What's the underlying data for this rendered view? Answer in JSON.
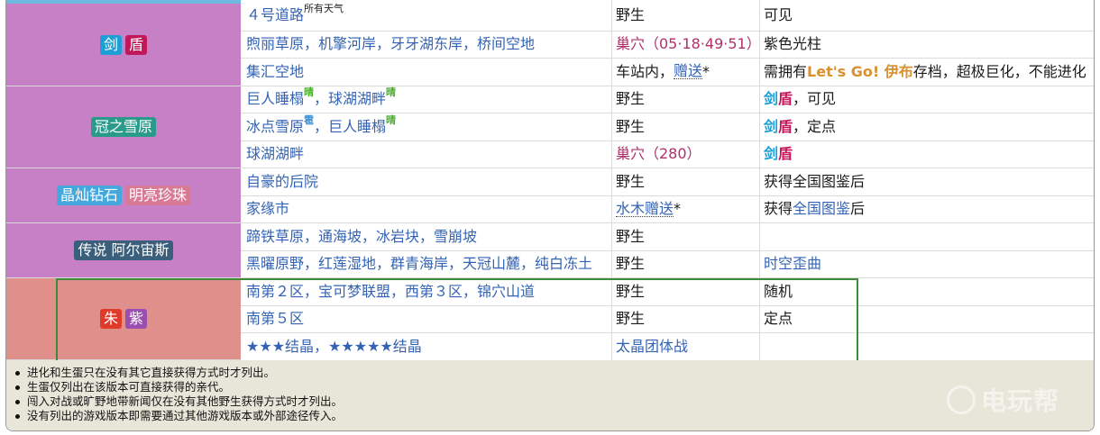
{
  "colors": {
    "sword": "#1d9fd6",
    "shield": "#c2185b",
    "crown_tundra": "#2a9a8a",
    "brilliant_diamond": "#45a8dc",
    "shining_pearl": "#d87a96",
    "legends_arceus": "#3b5f7a",
    "scarlet": "#e03a2a",
    "violet": "#9a4fb0",
    "link": "#3463b3",
    "highlight_border": "#3c8a3a"
  },
  "groups": [
    {
      "badges": [
        "剑",
        "盾"
      ]
    },
    {
      "badges": [
        "冠之雪原"
      ]
    },
    {
      "badges": [
        "晶灿钻石",
        "明亮珍珠"
      ]
    },
    {
      "badges": [
        "传说 阿尔宙斯"
      ]
    },
    {
      "badges": [
        "朱",
        "紫"
      ]
    }
  ],
  "rows": [
    {
      "loc": "４号道路",
      "loc_sup": "所有天气",
      "method": "野生",
      "note": "可见"
    },
    {
      "loc": "煦丽草原，机擎河岸，牙牙湖东岸，桥间空地",
      "method": "巢穴（05·18·49·51）",
      "note": "紫色光柱"
    },
    {
      "loc": "集汇空地",
      "method_a": "车站内，",
      "method_b": "赠送",
      "method_c": "*",
      "note_a": "需拥有",
      "note_b": "Let's Go! 伊布",
      "note_c": "存档，超极巨化，不能进化"
    },
    {
      "loc_a": "巨人睡榻",
      "loc_a_sup": "晴",
      "loc_b": "，球湖湖畔",
      "loc_b_sup": "晴",
      "method": "野生",
      "note_a": "剑",
      "note_b": "盾",
      "note_c": "，可见"
    },
    {
      "loc_a": "冰点雪原",
      "loc_a_sup": "雹",
      "loc_b": "，巨人睡榻",
      "loc_b_sup": "晴",
      "method": "野生",
      "note_a": "剑",
      "note_b": "盾",
      "note_c": "，定点"
    },
    {
      "loc": "球湖湖畔",
      "method": "巢穴（280）",
      "note_a": "剑",
      "note_b": "盾"
    },
    {
      "loc": "自豪的后院",
      "method": "野生",
      "note": "获得全国图鉴后"
    },
    {
      "loc": "家缘市",
      "method_a": "水木赠送",
      "method_b": "*",
      "note_a": "获得",
      "note_b": "全国图鉴",
      "note_c": "后"
    },
    {
      "loc": "蹄铁草原，通海坡，冰岩块，雪崩坡",
      "method": "野生",
      "note": ""
    },
    {
      "loc": "黑曜原野，红莲湿地，群青海岸，天冠山麓，纯白冻土",
      "method": "野生",
      "note": "时空歪曲"
    },
    {
      "loc": "南第２区，宝可梦联盟，西第３区，锦穴山道",
      "method": "野生",
      "note": "随机"
    },
    {
      "loc": "南第５区",
      "method": "野生",
      "note": "定点"
    },
    {
      "loc": "★★★结晶，★★★★★结晶",
      "method": "太晶团体战",
      "note": ""
    }
  ],
  "notes": [
    "进化和生蛋只在没有其它直接获得方式时才列出。",
    "生蛋仅列出在该版本可直接获得的亲代。",
    "闯入对战或旷野地带新闻仅在没有其他野生获得方式时才列出。",
    "没有列出的游戏版本即需要通过其他游戏版本或外部途径传入。"
  ],
  "watermark": "电玩帮"
}
